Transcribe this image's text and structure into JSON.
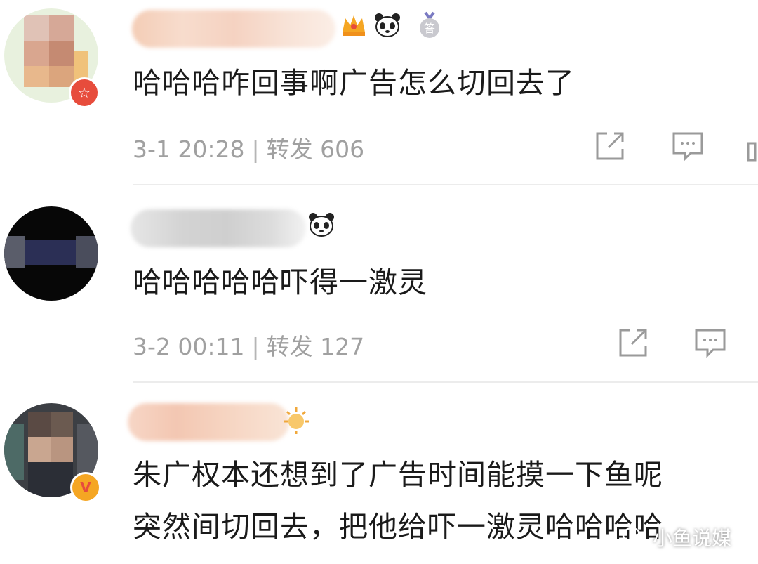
{
  "comments": [
    {
      "text": "哈哈哈咋回事啊广告怎么切回去了",
      "date": "3-1 20:28",
      "sep": "|",
      "repost_label": "转发",
      "repost_count": "606",
      "badges": [
        "crown-icon",
        "panda-icon",
        "medal-icon"
      ],
      "avatar_badge": "star-badge",
      "medal_char": "答"
    },
    {
      "text": "哈哈哈哈哈吓得一激灵",
      "date": "3-2 00:11",
      "sep": "|",
      "repost_label": "转发",
      "repost_count": "127",
      "badges": [
        "panda-icon"
      ]
    },
    {
      "text_line1": "朱广权本还想到了广告时间能摸一下鱼呢",
      "text_line2": "突然间切回去，把他给吓一激灵哈哈哈哈",
      "avatar_badge": "verified-badge",
      "avatar_badge_char": "V",
      "badges": [
        "sun-icon"
      ]
    }
  ],
  "watermark": {
    "text": "小鱼说媒",
    "icon": "wechat-icon"
  },
  "colors": {
    "meta_gray": "#a0a0a0",
    "text": "#1a1a1a",
    "badge_red": "#e74c3c",
    "badge_gold": "#f5a623"
  }
}
